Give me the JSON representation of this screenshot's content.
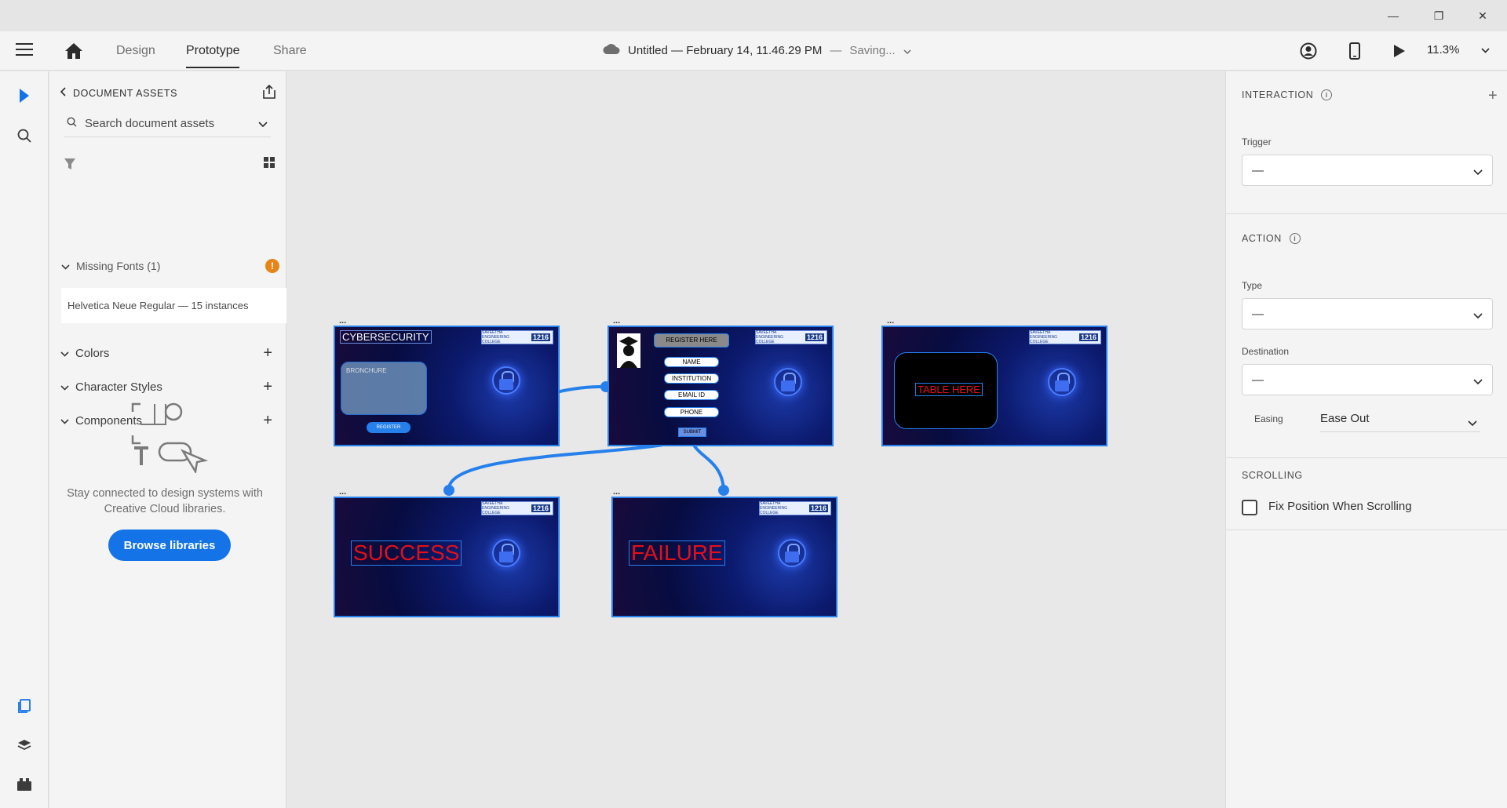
{
  "window": {
    "minimize": "—",
    "restore": "❐",
    "close": "✕"
  },
  "header": {
    "tabs": [
      {
        "label": "Design",
        "active": false
      },
      {
        "label": "Prototype",
        "active": true
      },
      {
        "label": "Share",
        "active": false
      }
    ],
    "doc_title": "Untitled — February 14, 11.46.29 PM",
    "separator": "—",
    "status": "Saving...",
    "zoom": "11.3%"
  },
  "assets": {
    "heading": "DOCUMENT ASSETS",
    "search_placeholder": "Search document assets",
    "missing_fonts": "Missing Fonts (1)",
    "missing_font_item": "Helvetica Neue Regular — 15 instances",
    "sections": [
      "Colors",
      "Character Styles",
      "Components"
    ],
    "library_message": "Stay connected to design systems with Creative Cloud libraries.",
    "browse_label": "Browse libraries"
  },
  "artboards": [
    {
      "label": "...",
      "title": "CYBERSECURITY",
      "brochure": "BRONCHURE",
      "button": "REGISTER"
    },
    {
      "label": "...",
      "title": "REGISTER HERE",
      "fields": [
        "NAME",
        "INSTITUTION",
        "EMAIL ID",
        "PHONE"
      ],
      "button": "SUBMIT"
    },
    {
      "label": "...",
      "title": "TABLE HERE"
    },
    {
      "label": "...",
      "title": "SUCCESS"
    },
    {
      "label": "...",
      "title": "FAILURE"
    }
  ],
  "logo_text": "SAVEETHA ENGINEERING COLLEGE",
  "logo_number": "1216",
  "properties": {
    "interaction_heading": "INTERACTION",
    "trigger_label": "Trigger",
    "trigger_value": "—",
    "action_heading": "ACTION",
    "type_label": "Type",
    "type_value": "—",
    "destination_label": "Destination",
    "destination_value": "—",
    "easing_label": "Easing",
    "easing_value": "Ease Out",
    "scrolling_heading": "SCROLLING",
    "fix_position_label": "Fix Position When Scrolling"
  },
  "colors": {
    "accent": "#1473e6",
    "warning": "#e68619",
    "wire": "#2680eb"
  }
}
